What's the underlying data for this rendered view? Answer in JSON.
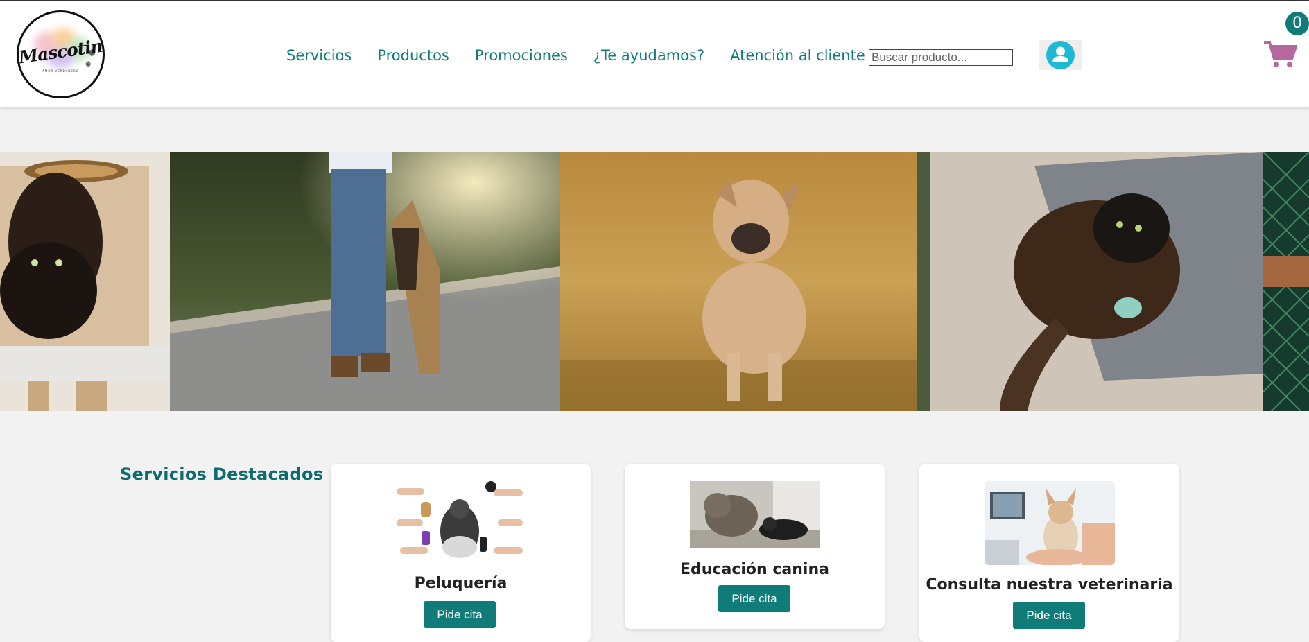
{
  "brand": {
    "logo_text": "Mascotines",
    "logo_tagline": "AMOR VERDADERO"
  },
  "nav": {
    "items": [
      {
        "label": "Servicios"
      },
      {
        "label": "Productos"
      },
      {
        "label": "Promociones"
      },
      {
        "label": "¿Te ayudamos?"
      },
      {
        "label": "Atención al cliente"
      }
    ]
  },
  "search": {
    "placeholder": "Buscar producto...",
    "value": ""
  },
  "user": {
    "icon": "user-icon"
  },
  "cart": {
    "icon": "cart-icon",
    "count": "0"
  },
  "carousel": {
    "slides": [
      {
        "subject": "black cat in cat tree"
      },
      {
        "subject": "man with german shepherd on road"
      },
      {
        "subject": "puppy standing in field"
      },
      {
        "subject": "cat lying on rug with toy"
      },
      {
        "subject": "green fence"
      }
    ]
  },
  "featured": {
    "title": "Servicios Destacados",
    "cards": [
      {
        "title": "Peluquería",
        "button": "Pide cita"
      },
      {
        "title": "Educación canina",
        "button": "Pide cita"
      },
      {
        "title": "Consulta nuestra veterinaria",
        "button": "Pide cita"
      }
    ]
  },
  "colors": {
    "accent": "#0f7c7a",
    "user_icon": "#1fb9d6",
    "cart": "#b4689f",
    "background": "#f2f2f2"
  }
}
